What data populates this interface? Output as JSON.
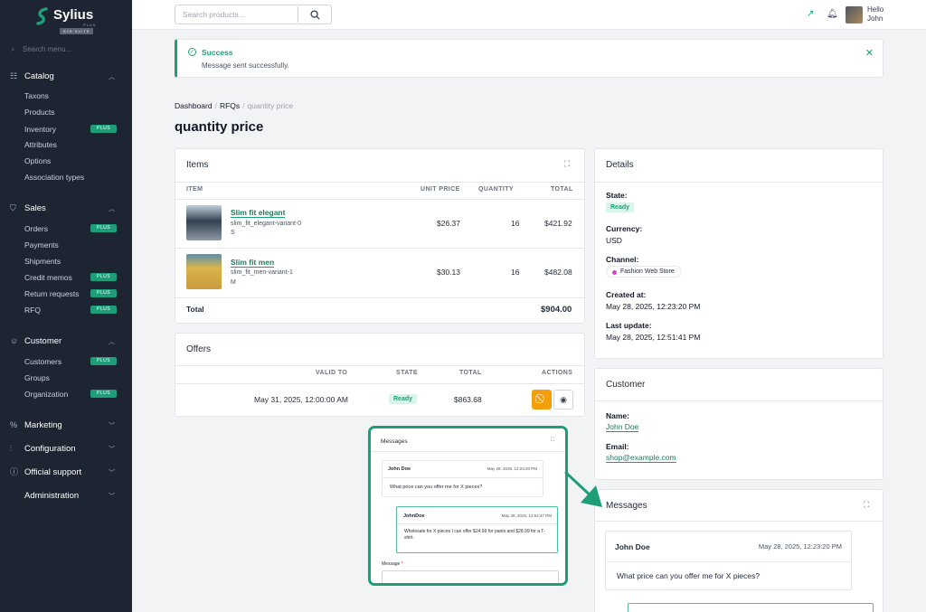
{
  "sidebar": {
    "brand": "Sylius",
    "brand_plus": "PLUS",
    "brand_suite": "B2B SUITE",
    "search_placeholder": "Search menu...",
    "plus_label": "PLUS",
    "catalog": {
      "label": "Catalog",
      "items": [
        "Taxons",
        "Products",
        "Inventory",
        "Attributes",
        "Options",
        "Association types"
      ]
    },
    "sales": {
      "label": "Sales",
      "items": [
        "Orders",
        "Payments",
        "Shipments",
        "Credit memos",
        "Return requests",
        "RFQ"
      ]
    },
    "customer": {
      "label": "Customer",
      "items": [
        "Customers",
        "Groups",
        "Organization"
      ]
    },
    "marketing": "Marketing",
    "configuration": "Configuration",
    "support": "Official support",
    "administration": "Administration"
  },
  "topbar": {
    "search_placeholder": "Search products...",
    "hello": "Hello",
    "user": "John"
  },
  "alert": {
    "title": "Success",
    "message": "Message sent successfully."
  },
  "breadcrumb": {
    "dashboard": "Dashboard",
    "rfqs": "RFQs",
    "current": "quantity price"
  },
  "page_title": "quantity price",
  "items_card": {
    "title": "Items",
    "headers": {
      "item": "ITEM",
      "unit_price": "UNIT PRICE",
      "quantity": "QUANTITY",
      "total": "TOTAL"
    },
    "rows": [
      {
        "name": "Slim fit elegant",
        "variant": "slim_fit_elegant-variant-0",
        "size": "S",
        "unit_price": "$26.37",
        "quantity": "16",
        "total": "$421.92"
      },
      {
        "name": "Slim fit men",
        "variant": "slim_fit_men-variant-1",
        "size": "M",
        "unit_price": "$30.13",
        "quantity": "16",
        "total": "$482.08"
      }
    ],
    "total_label": "Total",
    "total_value": "$904.00"
  },
  "offers_card": {
    "title": "Offers",
    "headers": {
      "valid_to": "VALID TO",
      "state": "STATE",
      "total": "TOTAL",
      "actions": "ACTIONS"
    },
    "row": {
      "valid_to": "May 31, 2025, 12:00:00 AM",
      "state": "Ready",
      "total": "$863.68"
    }
  },
  "details_card": {
    "title": "Details",
    "state_label": "State:",
    "state": "Ready",
    "currency_label": "Currency:",
    "currency": "USD",
    "channel_label": "Channel:",
    "channel": "Fashion Web Store",
    "created_label": "Created at:",
    "created": "May 28, 2025, 12:23:20 PM",
    "updated_label": "Last update:",
    "updated": "May 28, 2025, 12:51:41 PM"
  },
  "customer_card": {
    "title": "Customer",
    "name_label": "Name:",
    "name": "John Doe",
    "email_label": "Email:",
    "email": "shop@example.com"
  },
  "messages_card": {
    "title": "Messages",
    "msg1": {
      "author": "John Doe",
      "date": "May 28, 2025, 12:23:20 PM",
      "text": "What price can you offer me for X pieces?"
    }
  },
  "preview": {
    "title": "Messages",
    "msg1": {
      "author": "John Doe",
      "date": "May 28, 2025, 12:23:20 PM",
      "text": "What price can you offer me for X pieces?"
    },
    "msg2": {
      "author": "JohnDoe",
      "date": "May 28, 2025, 12:52:47 PM",
      "text": "Wholesale for X pieces I can offer $24.99 for pants and $28.99 for a T-shirt."
    },
    "message_label": "Message",
    "required_mark": "*"
  },
  "colors": {
    "accent": "#1e9e78",
    "sidebar_bg": "#1e2532",
    "warning": "#f59e0b"
  }
}
